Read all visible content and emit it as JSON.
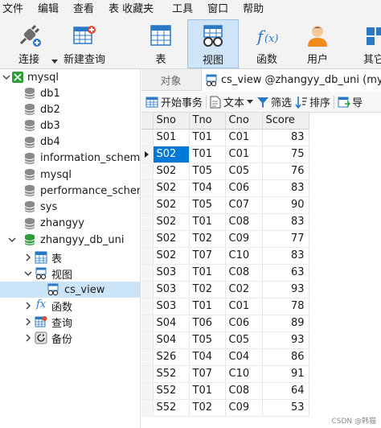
{
  "menubar": {
    "items": [
      "文件",
      "编辑",
      "查看",
      "表",
      "收藏夹",
      "工具",
      "窗口",
      "帮助"
    ]
  },
  "toolbar": {
    "connect": "连接",
    "new_query": "新建查询",
    "table": "表",
    "view": "视图",
    "function": "函数",
    "user": "用户",
    "other": "其它"
  },
  "tree": {
    "root": "mysql",
    "databases": [
      "db1",
      "db2",
      "db3",
      "db4",
      "information_schema",
      "mysql",
      "performance_schema",
      "sys",
      "zhangyy"
    ],
    "open_db": "zhangyy_db_uni",
    "tables_node": "表",
    "views_node": "视图",
    "view_item": "cs_view",
    "functions_node": "函数",
    "queries_node": "查询",
    "backup_node": "备份",
    "fx_glyph": "fx"
  },
  "tabs": {
    "objects": "对象",
    "active": "cs_view @zhangyy_db_uni (mysql)"
  },
  "subtoolbar": {
    "begin_tx": "开始事务",
    "text": "文本",
    "filter": "筛选",
    "sort": "排序",
    "export": "导"
  },
  "grid": {
    "columns": [
      "Sno",
      "Tno",
      "Cno",
      "Score"
    ],
    "rows": [
      [
        "S01",
        "T01",
        "C01",
        "83"
      ],
      [
        "S02",
        "T01",
        "C01",
        "75"
      ],
      [
        "S02",
        "T05",
        "C05",
        "76"
      ],
      [
        "S02",
        "T04",
        "C06",
        "83"
      ],
      [
        "S02",
        "T05",
        "C07",
        "90"
      ],
      [
        "S02",
        "T01",
        "C08",
        "83"
      ],
      [
        "S02",
        "T02",
        "C09",
        "77"
      ],
      [
        "S02",
        "T07",
        "C10",
        "83"
      ],
      [
        "S03",
        "T01",
        "C08",
        "63"
      ],
      [
        "S03",
        "T02",
        "C02",
        "93"
      ],
      [
        "S03",
        "T01",
        "C01",
        "78"
      ],
      [
        "S04",
        "T06",
        "C06",
        "89"
      ],
      [
        "S04",
        "T05",
        "C05",
        "93"
      ],
      [
        "S26",
        "T04",
        "C04",
        "86"
      ],
      [
        "S52",
        "T07",
        "C10",
        "91"
      ],
      [
        "S52",
        "T01",
        "C08",
        "64"
      ],
      [
        "S52",
        "T02",
        "C09",
        "53"
      ]
    ],
    "current_row": 1
  },
  "watermark": "CSDN @韩猫",
  "colors": {
    "selection": "#0078d7",
    "tree_selected": "#cce4f7",
    "db_green": "#2e9d3a",
    "accent_blue": "#2b78c5"
  }
}
